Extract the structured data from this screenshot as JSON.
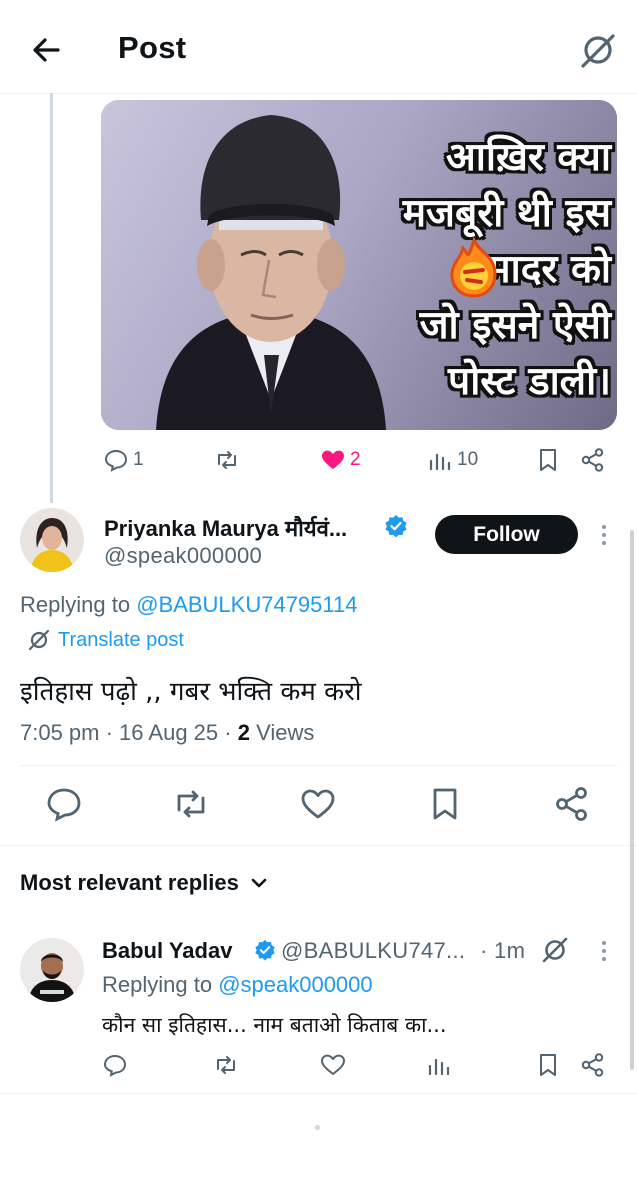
{
  "header": {
    "title": "Post"
  },
  "parent_post": {
    "meme_text": [
      "आख़िर क्या",
      "मजबूरी थी इस",
      "मादर को",
      "जो इसने ऐसी",
      "पोस्ट डाली।"
    ],
    "actions": {
      "replies": "1",
      "likes": "2",
      "views": "10"
    }
  },
  "post": {
    "author_name": "Priyanka Maurya मौर्यवं...",
    "handle": "@speak000000",
    "follow_label": "Follow",
    "replying_prefix": "Replying to ",
    "replying_to": "@BABULKU74795114",
    "translate_label": "Translate post",
    "text": "इतिहास पढ़ो ,, गबर भक्ति कम करो",
    "time": "7:05 pm · 16 Aug 25 · ",
    "views_count": "2",
    "views_label": " Views"
  },
  "replies_section": {
    "sort_label": "Most relevant replies"
  },
  "reply": {
    "author_name": "Babul Yadav",
    "handle": "@BABULKU747...",
    "time": "· 1m",
    "replying_prefix": "Replying to ",
    "replying_to": "@speak000000",
    "text": "कौन सा इतिहास... नाम बताओ किताब का..."
  },
  "colors": {
    "accent": "#1d9bf0",
    "like": "#f91880",
    "text": "#0f1419",
    "muted": "#536471"
  }
}
